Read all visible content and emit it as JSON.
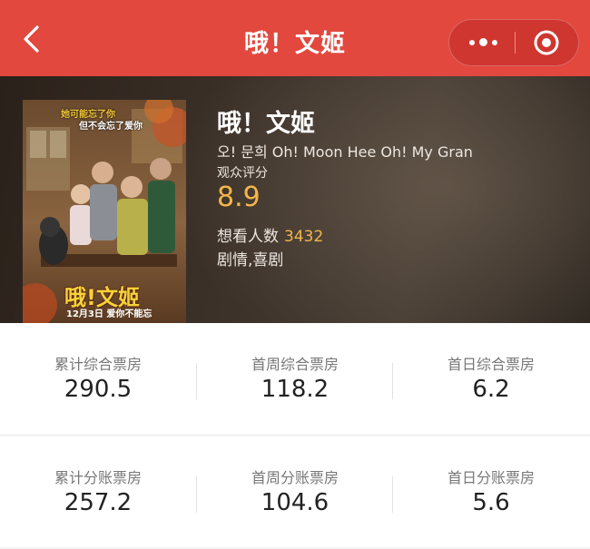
{
  "nav": {
    "title": "哦！文姬",
    "back_icon": "chevron-left-icon",
    "more_icon": "more-dots-icon",
    "close_icon": "target-close-icon",
    "bar_color": "#e2483e"
  },
  "poster": {
    "tagline_line1": "她可能忘了你",
    "tagline_line2": "但不会忘了爱你",
    "title": "哦!文姬",
    "date_line": "12月3日 爱你不能忘"
  },
  "film": {
    "title": "哦！文姬",
    "subtitle": "오! 문희 Oh! Moon Hee Oh! My Gran",
    "score_label": "观众评分",
    "score": "8.9",
    "wish_label": "想看人数",
    "wish_count": "3432",
    "genres": "剧情,喜剧",
    "accent_color": "#f2b64a"
  },
  "stats": [
    [
      {
        "label": "累计综合票房",
        "value": "290.5"
      },
      {
        "label": "首周综合票房",
        "value": "118.2"
      },
      {
        "label": "首日综合票房",
        "value": "6.2"
      }
    ],
    [
      {
        "label": "累计分账票房",
        "value": "257.2"
      },
      {
        "label": "首周分账票房",
        "value": "104.6"
      },
      {
        "label": "首日分账票房",
        "value": "5.6"
      }
    ]
  ]
}
